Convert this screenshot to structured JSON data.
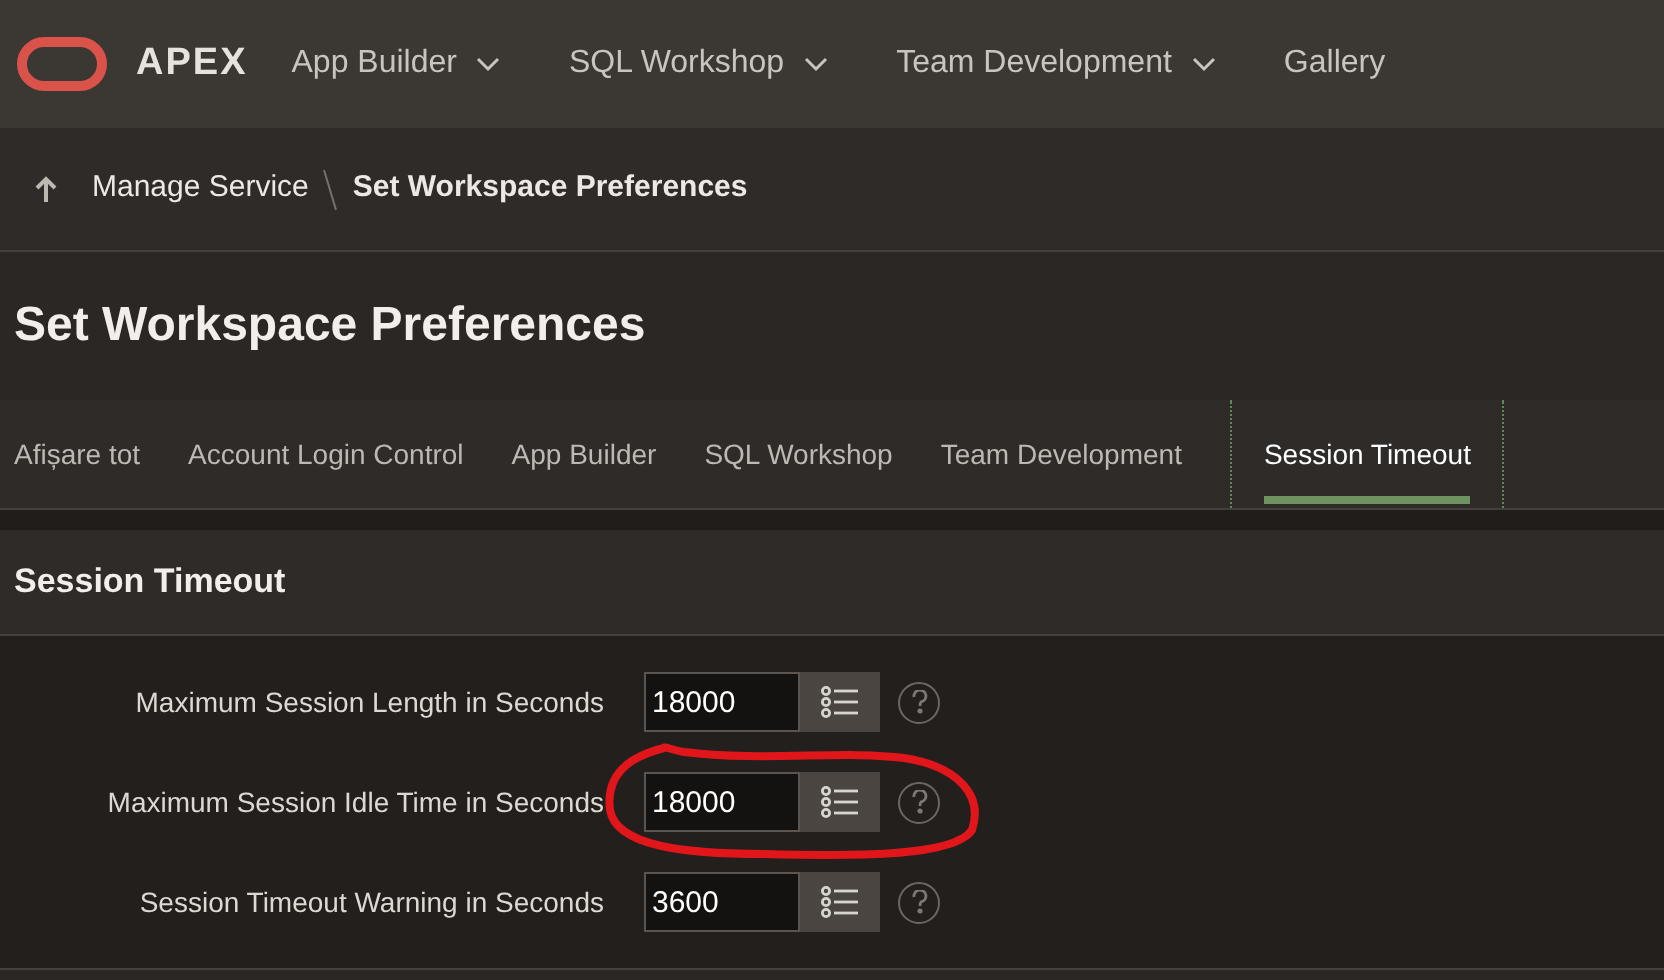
{
  "header": {
    "brand": "APEX",
    "menu": [
      {
        "label": "App Builder",
        "has_dropdown": true
      },
      {
        "label": "SQL Workshop",
        "has_dropdown": true
      },
      {
        "label": "Team Development",
        "has_dropdown": true
      },
      {
        "label": "Gallery",
        "has_dropdown": false
      }
    ]
  },
  "breadcrumb": {
    "parent": "Manage Service",
    "current": "Set Workspace Preferences"
  },
  "page_title": "Set Workspace Preferences",
  "tabs": [
    {
      "label": "Afișare tot",
      "selected": false
    },
    {
      "label": "Account Login Control",
      "selected": false
    },
    {
      "label": "App Builder",
      "selected": false
    },
    {
      "label": "SQL Workshop",
      "selected": false
    },
    {
      "label": "Team Development",
      "selected": false
    },
    {
      "label": "Session Timeout",
      "selected": true
    }
  ],
  "section": {
    "title": "Session Timeout",
    "fields": [
      {
        "label": "Maximum Session Length in Seconds",
        "value": "18000",
        "circled": false
      },
      {
        "label": "Maximum Session Idle Time in Seconds",
        "value": "18000",
        "circled": true
      },
      {
        "label": "Session Timeout Warning in Seconds",
        "value": "3600",
        "circled": false
      }
    ]
  }
}
